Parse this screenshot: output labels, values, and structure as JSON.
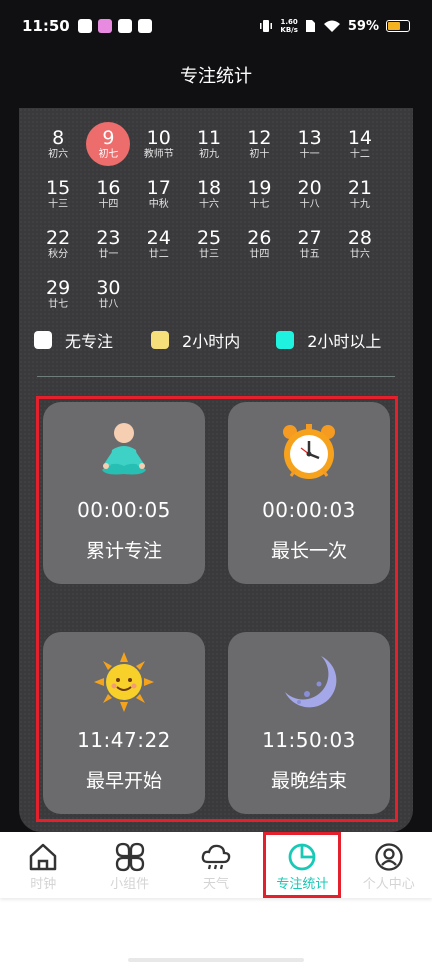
{
  "status_bar": {
    "time": "11:50",
    "net_speed_value": "1.60",
    "net_speed_unit": "KB/s",
    "battery_percent": "59%",
    "battery_level": 0.59
  },
  "page": {
    "title": "专注统计"
  },
  "calendar": {
    "days": [
      {
        "num": "8",
        "lunar": "初六"
      },
      {
        "num": "9",
        "lunar": "初七",
        "today": true
      },
      {
        "num": "10",
        "lunar": "教师节"
      },
      {
        "num": "11",
        "lunar": "初九"
      },
      {
        "num": "12",
        "lunar": "初十"
      },
      {
        "num": "13",
        "lunar": "十一"
      },
      {
        "num": "14",
        "lunar": "十二"
      },
      {
        "num": "15",
        "lunar": "十三"
      },
      {
        "num": "16",
        "lunar": "十四"
      },
      {
        "num": "17",
        "lunar": "中秋"
      },
      {
        "num": "18",
        "lunar": "十六"
      },
      {
        "num": "19",
        "lunar": "十七"
      },
      {
        "num": "20",
        "lunar": "十八"
      },
      {
        "num": "21",
        "lunar": "十九"
      },
      {
        "num": "22",
        "lunar": "秋分"
      },
      {
        "num": "23",
        "lunar": "廿一"
      },
      {
        "num": "24",
        "lunar": "廿二"
      },
      {
        "num": "25",
        "lunar": "廿三"
      },
      {
        "num": "26",
        "lunar": "廿四"
      },
      {
        "num": "27",
        "lunar": "廿五"
      },
      {
        "num": "28",
        "lunar": "廿六"
      },
      {
        "num": "29",
        "lunar": "廿七"
      },
      {
        "num": "30",
        "lunar": "廿八"
      }
    ]
  },
  "legend": [
    {
      "label": "无专注",
      "color": "#ffffff"
    },
    {
      "label": "2小时内",
      "color": "#f5df7a"
    },
    {
      "label": "2小时以上",
      "color": "#1ff2df"
    }
  ],
  "stats": {
    "total": {
      "value": "00:00:05",
      "label": "累计专注",
      "icon": "meditation-icon"
    },
    "longest": {
      "value": "00:00:03",
      "label": "最长一次",
      "icon": "alarm-clock-icon"
    },
    "earliest": {
      "value": "11:47:22",
      "label": "最早开始",
      "icon": "sun-icon"
    },
    "latest": {
      "value": "11:50:03",
      "label": "最晚结束",
      "icon": "moon-icon"
    }
  },
  "nav": {
    "items": [
      {
        "label": "时钟",
        "icon": "home-icon"
      },
      {
        "label": "小组件",
        "icon": "widgets-icon"
      },
      {
        "label": "天气",
        "icon": "weather-icon"
      },
      {
        "label": "专注统计",
        "icon": "pie-chart-icon",
        "active": true
      },
      {
        "label": "个人中心",
        "icon": "user-icon"
      }
    ]
  },
  "colors": {
    "today_bg": "#ec6d6b",
    "accent": "#18c9b6",
    "highlight_frame": "#e3202c",
    "card_bg": "#6b6b6d",
    "panel_bg": "#3a3a3d"
  }
}
